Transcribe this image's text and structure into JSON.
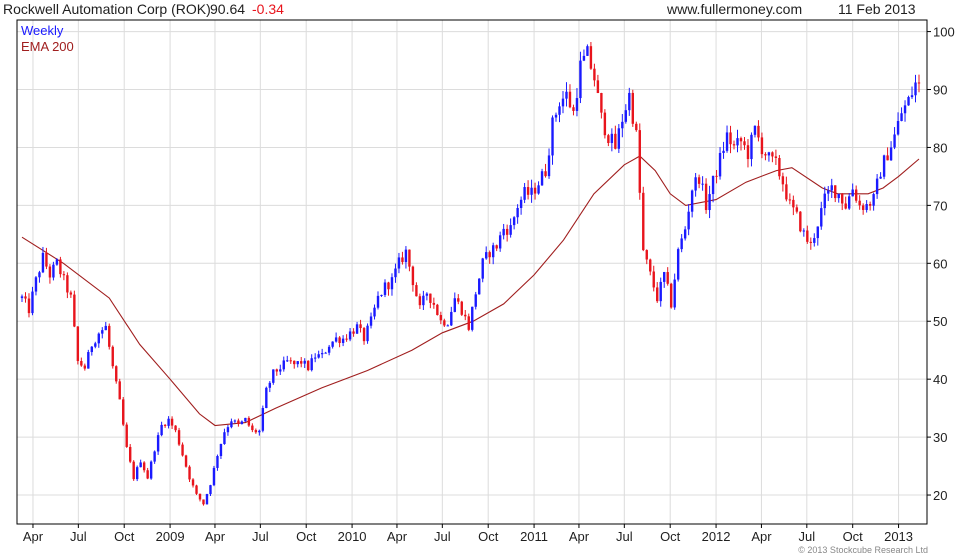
{
  "header": {
    "title": "Rockwell Automation Corp (ROK)",
    "last": "90.64",
    "change": "-0.34",
    "site": "www.fullermoney.com",
    "date": "11 Feb 2013"
  },
  "legend": {
    "weekly": "Weekly",
    "ema": "EMA 200"
  },
  "footer": {
    "copyright": "© 2013 Stockcube Research Ltd"
  },
  "colors": {
    "up": "#1a1aff",
    "down": "#e8141c",
    "ema": "#a01e1e",
    "grid": "#dcdcdc",
    "frame": "#000000"
  },
  "chart_data": {
    "type": "candlestick",
    "title": "Rockwell Automation Corp (ROK)",
    "interval": "weekly",
    "x_range": [
      "2008-03-10",
      "2013-02-11"
    ],
    "ylim": [
      15,
      102
    ],
    "y_ticks": [
      20,
      30,
      40,
      50,
      60,
      70,
      80,
      90,
      100
    ],
    "x_ticks": [
      {
        "date": "2008-04-01",
        "label": "Apr"
      },
      {
        "date": "2008-07-01",
        "label": "Jul"
      },
      {
        "date": "2008-10-01",
        "label": "Oct"
      },
      {
        "date": "2009-01-01",
        "label": "2009"
      },
      {
        "date": "2009-04-01",
        "label": "Apr"
      },
      {
        "date": "2009-07-01",
        "label": "Jul"
      },
      {
        "date": "2009-10-01",
        "label": "Oct"
      },
      {
        "date": "2010-01-01",
        "label": "2010"
      },
      {
        "date": "2010-04-01",
        "label": "Apr"
      },
      {
        "date": "2010-07-01",
        "label": "Jul"
      },
      {
        "date": "2010-10-01",
        "label": "Oct"
      },
      {
        "date": "2011-01-01",
        "label": "2011"
      },
      {
        "date": "2011-04-01",
        "label": "Apr"
      },
      {
        "date": "2011-07-01",
        "label": "Jul"
      },
      {
        "date": "2011-10-01",
        "label": "Oct"
      },
      {
        "date": "2012-01-01",
        "label": "2012"
      },
      {
        "date": "2012-04-01",
        "label": "Apr"
      },
      {
        "date": "2012-07-01",
        "label": "Jul"
      },
      {
        "date": "2012-10-01",
        "label": "Oct"
      },
      {
        "date": "2013-01-01",
        "label": "2013"
      }
    ],
    "grid": true,
    "close_anchors": [
      [
        "2008-03-10",
        54
      ],
      [
        "2008-03-24",
        52
      ],
      [
        "2008-04-07",
        57
      ],
      [
        "2008-04-21",
        61
      ],
      [
        "2008-05-05",
        58
      ],
      [
        "2008-05-19",
        60
      ],
      [
        "2008-06-02",
        57
      ],
      [
        "2008-06-16",
        54
      ],
      [
        "2008-06-30",
        43
      ],
      [
        "2008-07-14",
        42
      ],
      [
        "2008-07-28",
        46
      ],
      [
        "2008-08-11",
        48
      ],
      [
        "2008-08-25",
        49
      ],
      [
        "2008-09-08",
        42
      ],
      [
        "2008-09-22",
        36
      ],
      [
        "2008-10-06",
        28
      ],
      [
        "2008-10-20",
        23
      ],
      [
        "2008-11-03",
        26
      ],
      [
        "2008-11-17",
        23
      ],
      [
        "2008-12-01",
        28
      ],
      [
        "2008-12-15",
        32
      ],
      [
        "2008-12-29",
        33
      ],
      [
        "2009-01-12",
        31
      ],
      [
        "2009-01-26",
        27
      ],
      [
        "2009-02-09",
        23
      ],
      [
        "2009-02-23",
        20
      ],
      [
        "2009-03-09",
        18.5
      ],
      [
        "2009-03-23",
        22
      ],
      [
        "2009-04-06",
        27
      ],
      [
        "2009-04-20",
        31
      ],
      [
        "2009-05-04",
        33
      ],
      [
        "2009-05-18",
        32
      ],
      [
        "2009-06-01",
        33
      ],
      [
        "2009-06-15",
        31
      ],
      [
        "2009-06-29",
        31
      ],
      [
        "2009-07-13",
        38
      ],
      [
        "2009-07-27",
        41
      ],
      [
        "2009-08-10",
        42
      ],
      [
        "2009-08-24",
        43
      ],
      [
        "2009-09-07",
        42.5
      ],
      [
        "2009-09-21",
        43
      ],
      [
        "2009-10-05",
        42
      ],
      [
        "2009-10-19",
        44
      ],
      [
        "2009-11-02",
        44
      ],
      [
        "2009-11-16",
        46
      ],
      [
        "2009-11-30",
        47
      ],
      [
        "2009-12-14",
        47
      ],
      [
        "2009-12-28",
        48
      ],
      [
        "2010-01-11",
        49
      ],
      [
        "2010-01-25",
        47
      ],
      [
        "2010-02-08",
        50
      ],
      [
        "2010-02-22",
        54
      ],
      [
        "2010-03-08",
        56
      ],
      [
        "2010-03-22",
        57
      ],
      [
        "2010-04-05",
        60
      ],
      [
        "2010-04-19",
        62
      ],
      [
        "2010-05-03",
        57
      ],
      [
        "2010-05-17",
        52
      ],
      [
        "2010-05-31",
        55
      ],
      [
        "2010-06-14",
        53
      ],
      [
        "2010-06-28",
        50
      ],
      [
        "2010-07-12",
        50
      ],
      [
        "2010-07-26",
        54
      ],
      [
        "2010-08-09",
        52
      ],
      [
        "2010-08-23",
        49
      ],
      [
        "2010-09-06",
        55
      ],
      [
        "2010-09-20",
        60
      ],
      [
        "2010-10-04",
        62
      ],
      [
        "2010-10-18",
        63
      ],
      [
        "2010-11-01",
        66
      ],
      [
        "2010-11-15",
        66
      ],
      [
        "2010-11-29",
        70
      ],
      [
        "2010-12-13",
        72
      ],
      [
        "2010-12-27",
        72
      ],
      [
        "2011-01-10",
        74
      ],
      [
        "2011-01-24",
        76
      ],
      [
        "2011-02-07",
        84
      ],
      [
        "2011-02-21",
        88
      ],
      [
        "2011-03-07",
        89
      ],
      [
        "2011-03-21",
        86
      ],
      [
        "2011-04-04",
        94
      ],
      [
        "2011-04-18",
        96
      ],
      [
        "2011-05-02",
        92
      ],
      [
        "2011-05-16",
        85
      ],
      [
        "2011-05-30",
        82
      ],
      [
        "2011-06-13",
        80
      ],
      [
        "2011-06-27",
        85
      ],
      [
        "2011-07-11",
        89
      ],
      [
        "2011-07-25",
        82
      ],
      [
        "2011-08-08",
        62
      ],
      [
        "2011-08-22",
        58
      ],
      [
        "2011-09-05",
        54
      ],
      [
        "2011-09-19",
        58
      ],
      [
        "2011-10-03",
        53
      ],
      [
        "2011-10-17",
        62
      ],
      [
        "2011-10-31",
        66
      ],
      [
        "2011-11-14",
        73
      ],
      [
        "2011-11-28",
        75
      ],
      [
        "2011-12-12",
        70
      ],
      [
        "2011-12-26",
        74
      ],
      [
        "2012-01-09",
        78
      ],
      [
        "2012-01-23",
        82
      ],
      [
        "2012-02-06",
        80
      ],
      [
        "2012-02-20",
        81
      ],
      [
        "2012-03-05",
        79
      ],
      [
        "2012-03-19",
        83
      ],
      [
        "2012-04-02",
        80
      ],
      [
        "2012-04-16",
        78
      ],
      [
        "2012-04-30",
        77
      ],
      [
        "2012-05-14",
        74
      ],
      [
        "2012-05-28",
        70
      ],
      [
        "2012-06-11",
        68
      ],
      [
        "2012-06-25",
        65
      ],
      [
        "2012-07-09",
        63
      ],
      [
        "2012-07-23",
        67
      ],
      [
        "2012-08-06",
        71
      ],
      [
        "2012-08-20",
        73
      ],
      [
        "2012-09-03",
        72
      ],
      [
        "2012-09-17",
        70
      ],
      [
        "2012-10-01",
        73
      ],
      [
        "2012-10-15",
        70
      ],
      [
        "2012-10-29",
        70
      ],
      [
        "2012-11-12",
        71
      ],
      [
        "2012-11-26",
        76
      ],
      [
        "2012-12-10",
        79
      ],
      [
        "2012-12-24",
        82
      ],
      [
        "2013-01-07",
        86
      ],
      [
        "2013-01-21",
        88
      ],
      [
        "2013-02-04",
        91
      ],
      [
        "2013-02-11",
        90.64
      ]
    ],
    "ema_anchors": [
      [
        "2008-03-10",
        64.5
      ],
      [
        "2008-06-01",
        60
      ],
      [
        "2008-09-01",
        54
      ],
      [
        "2008-11-01",
        46
      ],
      [
        "2009-01-01",
        40
      ],
      [
        "2009-03-01",
        34
      ],
      [
        "2009-04-01",
        32
      ],
      [
        "2009-06-01",
        32.5
      ],
      [
        "2009-08-01",
        35
      ],
      [
        "2009-11-01",
        38.5
      ],
      [
        "2010-02-01",
        41.5
      ],
      [
        "2010-05-01",
        45
      ],
      [
        "2010-07-01",
        48
      ],
      [
        "2010-09-01",
        50
      ],
      [
        "2010-11-01",
        53
      ],
      [
        "2011-01-01",
        58
      ],
      [
        "2011-03-01",
        64
      ],
      [
        "2011-05-01",
        72
      ],
      [
        "2011-07-01",
        77
      ],
      [
        "2011-08-01",
        78.5
      ],
      [
        "2011-09-01",
        76
      ],
      [
        "2011-10-01",
        72
      ],
      [
        "2011-11-01",
        70
      ],
      [
        "2012-01-01",
        71
      ],
      [
        "2012-03-01",
        74
      ],
      [
        "2012-05-01",
        76
      ],
      [
        "2012-06-01",
        76.5
      ],
      [
        "2012-08-01",
        73
      ],
      [
        "2012-09-01",
        72
      ],
      [
        "2012-11-01",
        72
      ],
      [
        "2012-12-01",
        73
      ],
      [
        "2013-01-01",
        75
      ],
      [
        "2013-02-11",
        78
      ]
    ]
  }
}
